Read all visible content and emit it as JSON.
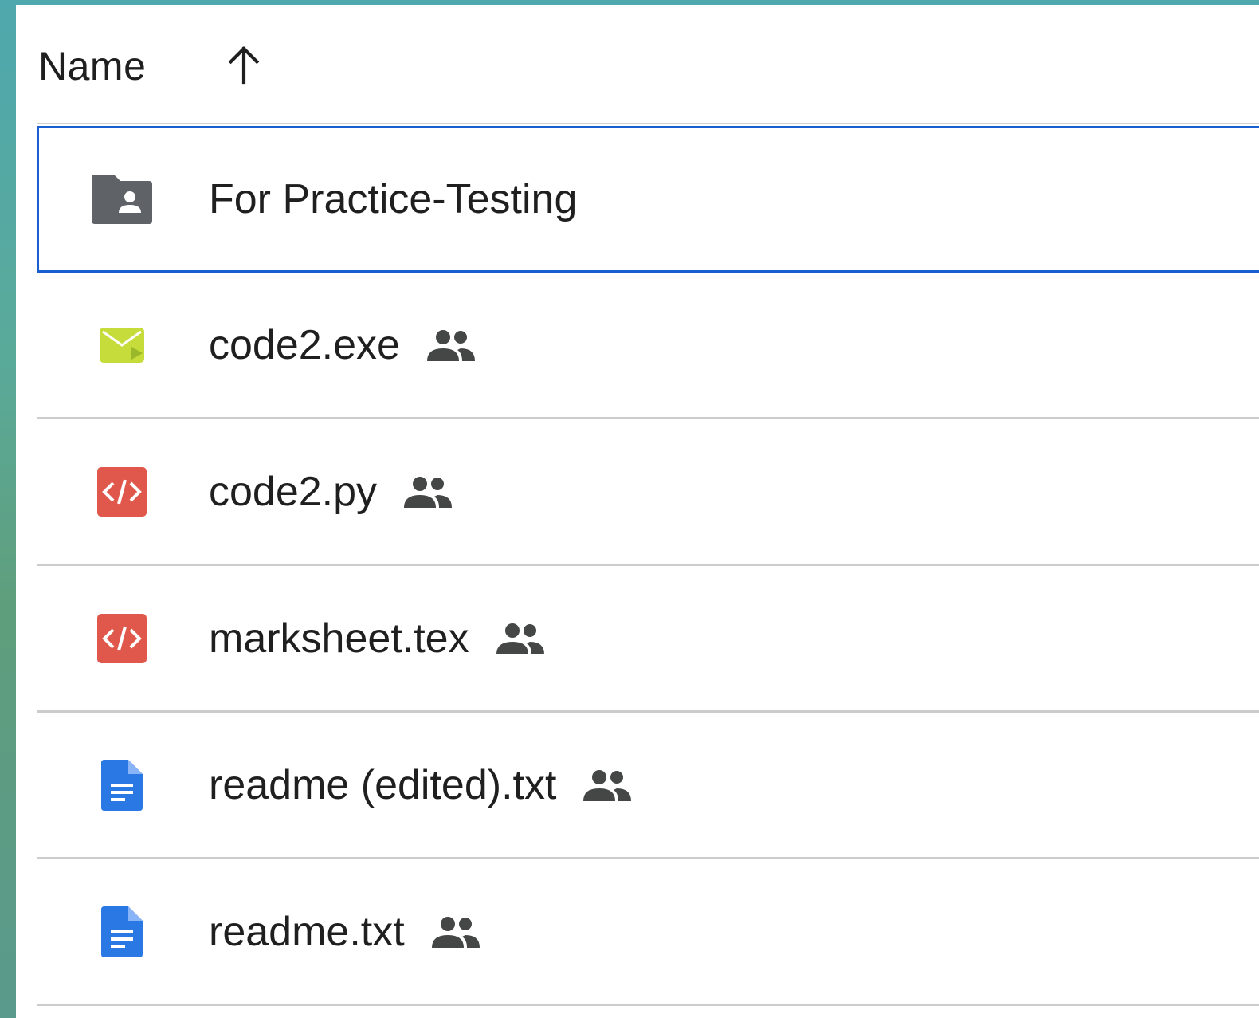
{
  "header": {
    "name_label": "Name",
    "sort_icon": "arrow-up-icon",
    "sort_direction": "ascending"
  },
  "files": [
    {
      "name": "For Practice-Testing",
      "icon": "shared-folder-icon",
      "shared": false,
      "selected": true
    },
    {
      "name": "code2.exe",
      "icon": "video-file-icon",
      "shared": true,
      "selected": false
    },
    {
      "name": "code2.py",
      "icon": "code-file-icon",
      "shared": true,
      "selected": false
    },
    {
      "name": "marksheet.tex",
      "icon": "code-file-icon",
      "shared": true,
      "selected": false
    },
    {
      "name": "readme (edited).txt",
      "icon": "document-icon",
      "shared": true,
      "selected": false
    },
    {
      "name": "readme.txt",
      "icon": "document-icon",
      "shared": true,
      "selected": false
    }
  ],
  "colors": {
    "selection_border": "#1a5fcf",
    "folder_icon": "#5f6368",
    "video_icon": "#c6dc3a",
    "code_icon": "#e0574b",
    "document_icon": "#2a78e4",
    "shared_icon": "#444746"
  }
}
